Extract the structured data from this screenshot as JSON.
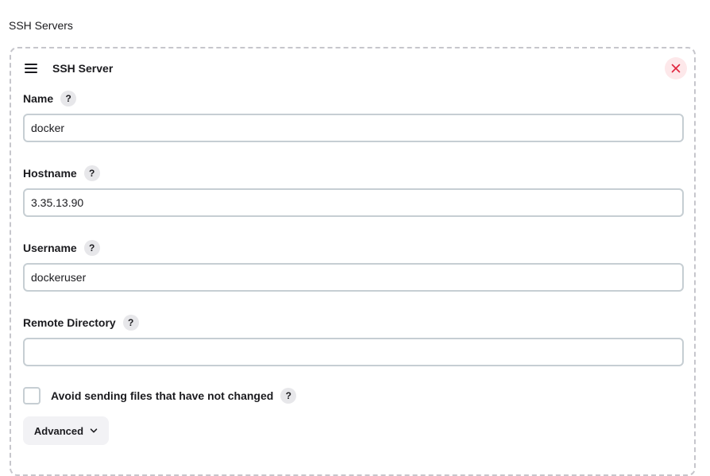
{
  "section": {
    "title": "SSH Servers"
  },
  "server": {
    "title": "SSH Server",
    "fields": {
      "name": {
        "label": "Name",
        "value": "docker"
      },
      "hostname": {
        "label": "Hostname",
        "value": "3.35.13.90"
      },
      "username": {
        "label": "Username",
        "value": "dockeruser"
      },
      "remote_directory": {
        "label": "Remote Directory",
        "value": ""
      }
    },
    "avoid_sending": {
      "label": "Avoid sending files that have not changed",
      "checked": false
    },
    "advanced": {
      "label": "Advanced"
    },
    "help_glyph": "?"
  },
  "colors": {
    "close_bg": "#fde8ea",
    "close_icon": "#e0243c",
    "input_border": "#c6ced3",
    "card_border": "#c6c6cc"
  },
  "icons": [
    "drag-handle-icon",
    "close-icon",
    "help-icon",
    "chevron-down-icon"
  ]
}
